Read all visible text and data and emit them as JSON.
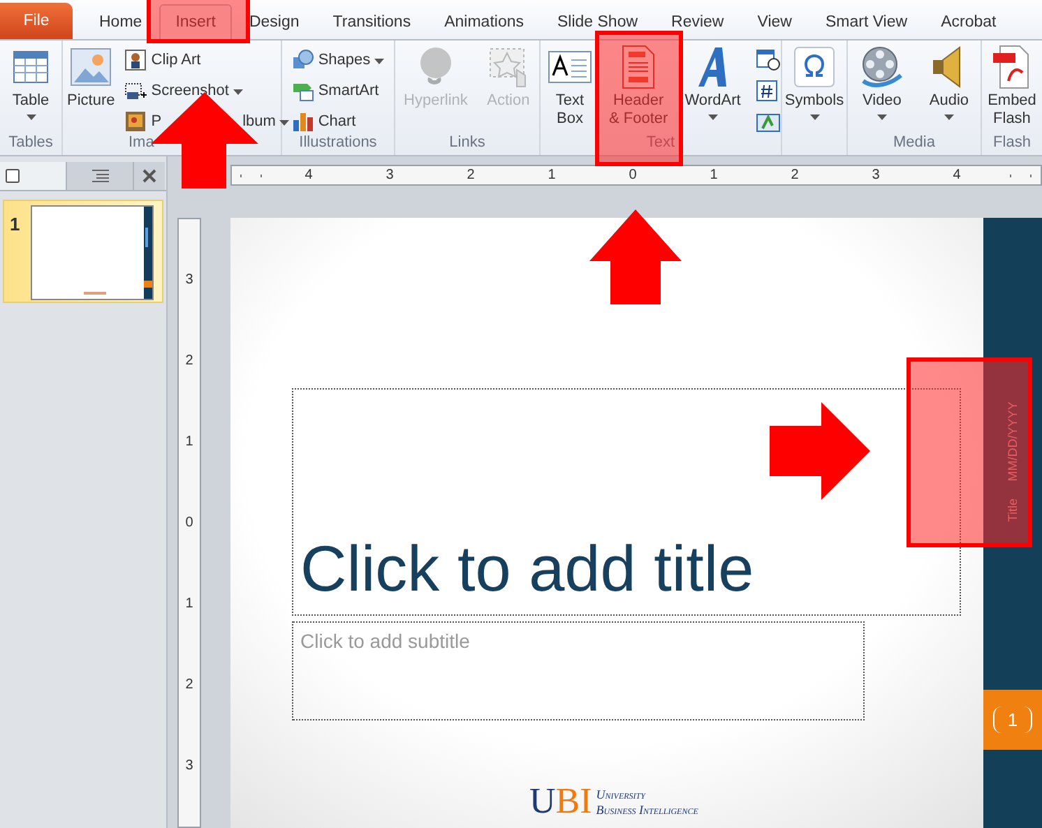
{
  "tabs": [
    {
      "label": "File",
      "kind": "file",
      "selected": false
    },
    {
      "label": "Home",
      "kind": "tab",
      "selected": false
    },
    {
      "label": "Insert",
      "kind": "tab",
      "selected": true
    },
    {
      "label": "Design",
      "kind": "tab",
      "selected": false
    },
    {
      "label": "Transitions",
      "kind": "tab",
      "selected": false
    },
    {
      "label": "Animations",
      "kind": "tab",
      "selected": false
    },
    {
      "label": "Slide Show",
      "kind": "tab",
      "selected": false
    },
    {
      "label": "Review",
      "kind": "tab",
      "selected": false
    },
    {
      "label": "View",
      "kind": "tab",
      "selected": false
    },
    {
      "label": "Smart View",
      "kind": "tab",
      "selected": false
    },
    {
      "label": "Acrobat",
      "kind": "tab",
      "selected": false
    }
  ],
  "ribbon": {
    "groups": [
      {
        "label": "Tables",
        "items": [
          {
            "kind": "large",
            "label_lines": [
              "Table"
            ],
            "dropdown": true,
            "disabled": false
          }
        ]
      },
      {
        "label": "Ima",
        "items": [
          {
            "kind": "large",
            "label_lines": [
              "Picture"
            ],
            "dropdown": false,
            "disabled": false
          },
          {
            "kind": "small",
            "label": "Clip Art",
            "dropdown": false,
            "disabled": false
          },
          {
            "kind": "small",
            "label": "Screenshot",
            "dropdown": true,
            "disabled": false
          },
          {
            "kind": "small",
            "label": "P",
            "label_tail": "lbum",
            "dropdown": true,
            "disabled": false
          }
        ]
      },
      {
        "label": "Illustrations",
        "items": [
          {
            "kind": "small",
            "label": "Shapes",
            "dropdown": true,
            "disabled": false
          },
          {
            "kind": "small",
            "label": "SmartArt",
            "dropdown": false,
            "disabled": false
          },
          {
            "kind": "small",
            "label": "Chart",
            "dropdown": false,
            "disabled": false
          }
        ]
      },
      {
        "label": "Links",
        "items": [
          {
            "kind": "large",
            "label_lines": [
              "Hyperlink"
            ],
            "dropdown": false,
            "disabled": true
          },
          {
            "kind": "large",
            "label_lines": [
              "Action"
            ],
            "dropdown": false,
            "disabled": true
          }
        ]
      },
      {
        "label": "Text",
        "items": [
          {
            "kind": "large",
            "label_lines": [
              "Text",
              "Box"
            ],
            "dropdown": false,
            "disabled": false
          },
          {
            "kind": "large",
            "label_lines": [
              "Header",
              "& Footer"
            ],
            "dropdown": false,
            "disabled": false
          },
          {
            "kind": "large",
            "label_lines": [
              "WordArt"
            ],
            "dropdown": true,
            "disabled": false
          },
          {
            "kind": "small_icon",
            "disabled": false
          },
          {
            "kind": "small_icon",
            "disabled": false
          },
          {
            "kind": "small_icon",
            "disabled": false
          }
        ]
      },
      {
        "items": [
          {
            "kind": "large",
            "label_lines": [
              "Symbols"
            ],
            "dropdown": true,
            "disabled": false
          }
        ]
      },
      {
        "label": "Media",
        "items": [
          {
            "kind": "large",
            "label_lines": [
              "Video"
            ],
            "dropdown": true,
            "disabled": false
          },
          {
            "kind": "large",
            "label_lines": [
              "Audio"
            ],
            "dropdown": true,
            "disabled": false
          }
        ]
      },
      {
        "label": "Flash",
        "items": [
          {
            "kind": "large",
            "label_lines": [
              "Embed",
              "Flash"
            ],
            "dropdown": false,
            "disabled": false
          }
        ]
      }
    ]
  },
  "slides_pane": {
    "thumbnails": [
      {
        "number": "1",
        "selected": true
      }
    ]
  },
  "horizontal_ruler": [
    "4",
    "3",
    "2",
    "1",
    "0",
    "1",
    "2",
    "3",
    "4"
  ],
  "vertical_ruler": [
    "3",
    "2",
    "1",
    "0",
    "1",
    "2",
    "3"
  ],
  "slide": {
    "title_placeholder": "Click to add title",
    "subtitle_placeholder": "Click to add subtitle",
    "side_bar": {
      "title": "Title",
      "date": "MM/DD/YYYY",
      "slide_number": "1"
    },
    "logo": {
      "mark": "UBI",
      "line_1": "University",
      "line_2": "Business Intelligence"
    }
  }
}
